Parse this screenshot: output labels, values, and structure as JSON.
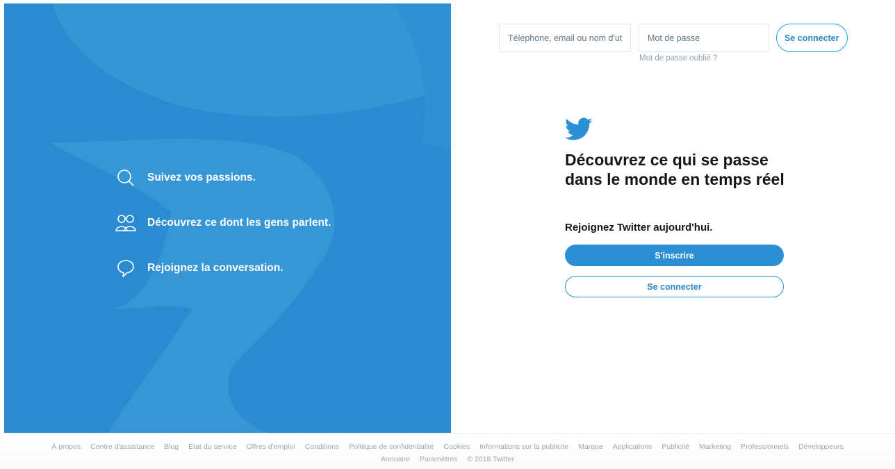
{
  "features": [
    {
      "icon": "search-icon",
      "text": "Suivez vos passions."
    },
    {
      "icon": "people-icon",
      "text": "Découvrez ce dont les gens parlent."
    },
    {
      "icon": "speech-bubble-icon",
      "text": "Rejoignez la conversation."
    }
  ],
  "login": {
    "phone_placeholder": "Téléphone, email ou nom d'utilisateur",
    "password_placeholder": "Mot de passe",
    "button_label": "Se connecter",
    "forgot_label": "Mot de passe oublié ?"
  },
  "main": {
    "headline": "Découvrez ce qui se passe dans le monde en temps réel",
    "join_text": "Rejoignez Twitter aujourd'hui.",
    "signup_label": "S'inscrire",
    "signin_label": "Se connecter"
  },
  "footer": {
    "row1": [
      "À propos",
      "Centre d'assistance",
      "Blog",
      "État du service",
      "Offres d'emploi",
      "Conditions",
      "Politique de confidentialité",
      "Cookies",
      "Informations sur la publicite",
      "Marque",
      "Applications",
      "Publicité",
      "Marketing",
      "Professionnels",
      "Développeurs"
    ],
    "row2": [
      "Annuaire",
      "Paramètres"
    ],
    "copyright": "© 2018 Twitter"
  },
  "colors": {
    "brand_blue": "#2a8bd0",
    "button_blue": "#2b8fd6",
    "link_blue": "#2b86c9"
  }
}
